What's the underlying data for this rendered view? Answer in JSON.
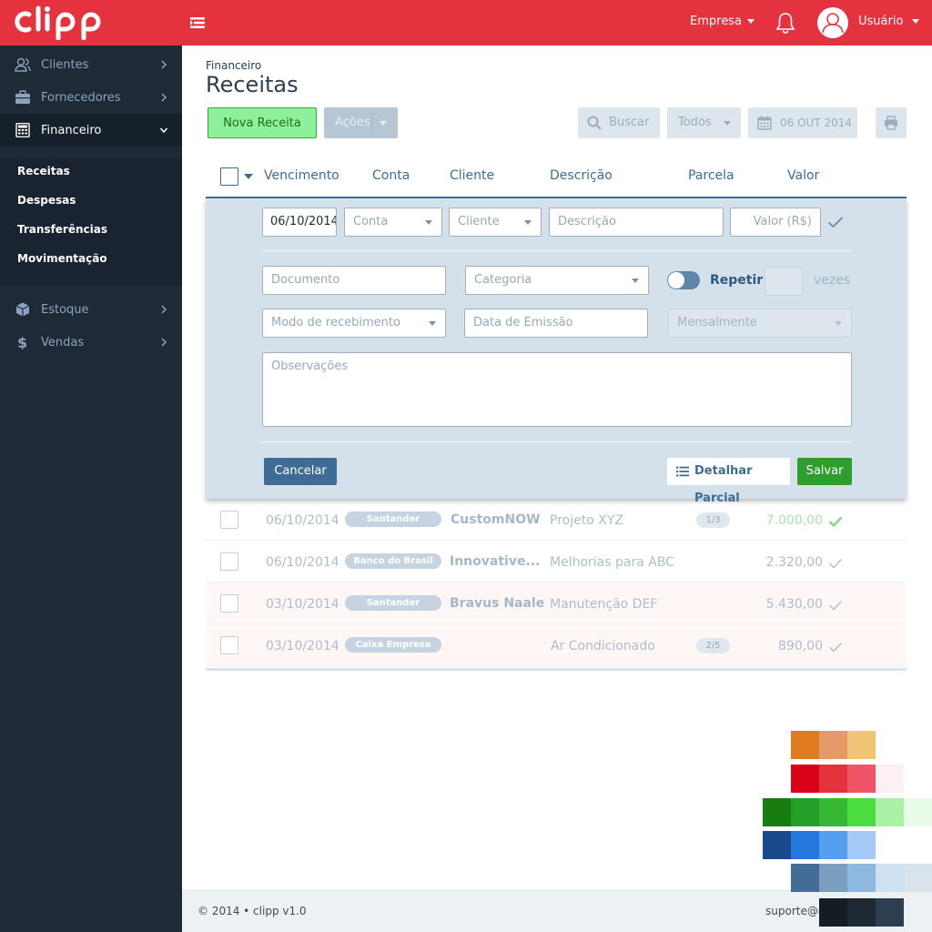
{
  "topbar": {
    "logo_text": "clipp",
    "company_label": "Empresa",
    "user_label": "Usuário",
    "brand_color": "#e4323f"
  },
  "sidebar": {
    "items": [
      {
        "label": "Clientes",
        "icon": "users-icon"
      },
      {
        "label": "Fornecedores",
        "icon": "briefcase-icon"
      },
      {
        "label": "Financeiro",
        "icon": "calculator-icon",
        "active": true
      },
      {
        "label": "Estoque",
        "icon": "cube-icon"
      },
      {
        "label": "Vendas",
        "icon": "dollar-icon"
      }
    ],
    "subitems": [
      "Receitas",
      "Despesas",
      "Transferências",
      "Movimentação"
    ]
  },
  "page": {
    "breadcrumb": "Financeiro",
    "title": "Receitas"
  },
  "toolbar": {
    "new_label": "Nova Receita",
    "actions_label": "Ações",
    "search_label": "Buscar",
    "filter_label": "Todos",
    "date_label": "06 OUT 2014"
  },
  "table": {
    "headers": [
      "Vencimento",
      "Conta",
      "Cliente",
      "Descrição",
      "Parcela",
      "Valor"
    ],
    "rows": [
      {
        "date": "06/10/2014",
        "bank": "Santander",
        "client": "CustomNOW",
        "description": "Projeto XYZ",
        "parcel": "1/3",
        "value": "7.000,00",
        "paid": true,
        "overdue": false
      },
      {
        "date": "06/10/2014",
        "bank": "Banco do Brasil",
        "client": "Innovative...",
        "description": "Melhorias para ABC",
        "parcel": "",
        "value": "2.320,00",
        "paid": false,
        "overdue": false
      },
      {
        "date": "03/10/2014",
        "bank": "Santander",
        "client": "Bravus Naale",
        "description": "Manutenção DEF",
        "parcel": "",
        "value": "5.430,00",
        "paid": false,
        "overdue": true
      },
      {
        "date": "03/10/2014",
        "bank": "Caixa Empresa",
        "client": "",
        "description": "Ar Condicionado",
        "parcel": "2/5",
        "value": "890,00",
        "paid": false,
        "overdue": true
      }
    ]
  },
  "form": {
    "date_value": "06/10/2014",
    "account_placeholder": "Conta",
    "client_placeholder": "Cliente",
    "description_placeholder": "Descrição",
    "value_placeholder": "Valor (R$)",
    "document_placeholder": "Documento",
    "category_placeholder": "Categoria",
    "repeat_label": "Repetir",
    "times_label": "vezes",
    "receipt_mode_placeholder": "Modo de recebimento",
    "issue_date_placeholder": "Data de Emissão",
    "frequency_value": "Mensalmente",
    "notes_placeholder": "Observações",
    "cancel_label": "Cancelar",
    "detail_label": "Detalhar Parcial",
    "save_label": "Salvar"
  },
  "palette": {
    "rows": [
      [
        "#e07a1f",
        "#e69a68",
        "#efc475"
      ],
      [
        "#d9001a",
        "#e4323f",
        "#f05468",
        "#fdf0f2"
      ],
      [
        "#187c11",
        "#259e25",
        "#36b836",
        "#4bdd3d",
        "#a8f1a5",
        "#e8fbe8"
      ],
      [
        "#1a4a8c",
        "#2477dd",
        "#559ff0",
        "#a5c9f6"
      ],
      [
        "#436d96",
        "#7b9fbe",
        "#8db9e0",
        "#d0e1f3",
        "#d8e3eb"
      ],
      [
        "#141c24",
        "#1e2934",
        "#2c3e50"
      ]
    ]
  },
  "footer": {
    "copyright": "© 2014 • clipp v1.0",
    "support": "suporte@c"
  }
}
